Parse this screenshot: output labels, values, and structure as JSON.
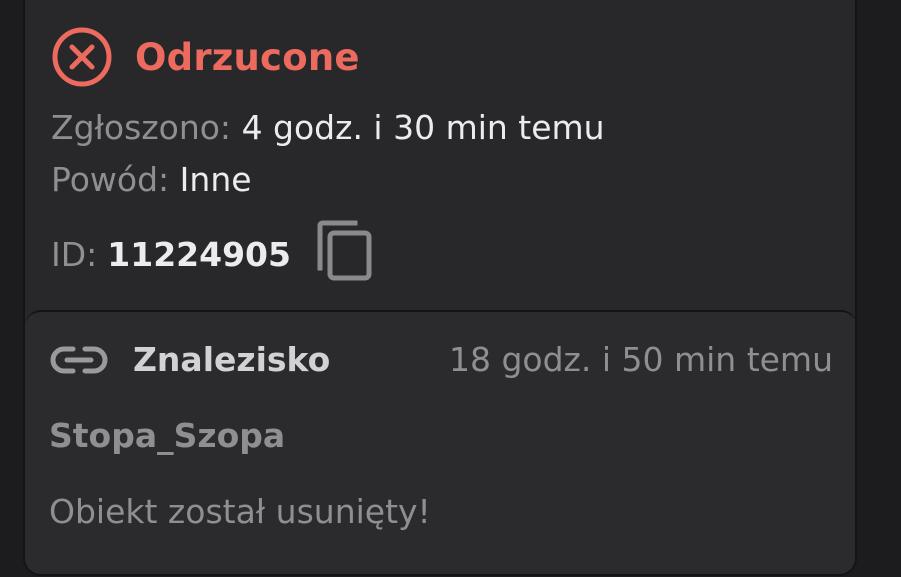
{
  "status": {
    "label": "Odrzucone",
    "icon": "x-circle-icon",
    "color": "#ec6a5e"
  },
  "details": {
    "reported_key": "Zgłoszono:",
    "reported_value": "4 godz. i 30 min temu",
    "reason_key": "Powód:",
    "reason_value": "Inne",
    "id_key": "ID:",
    "id_value": "11224905",
    "copy_icon": "copy-icon"
  },
  "object": {
    "icon": "link-icon",
    "type": "Znalezisko",
    "time": "18 godz. i 50 min temu",
    "author": "Stopa_Szopa",
    "message": "Obiekt został usunięty!"
  }
}
